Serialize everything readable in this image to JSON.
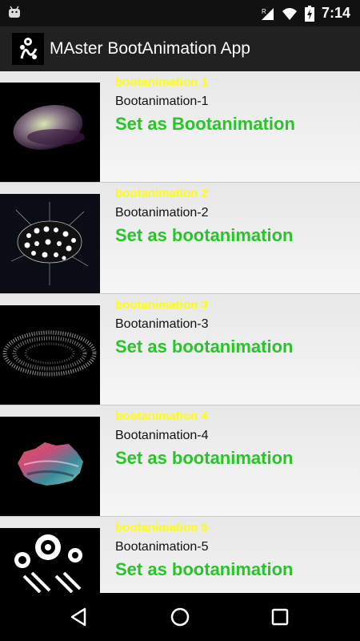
{
  "status_bar": {
    "time": "7:14",
    "icons": [
      "android-icon",
      "signal-r-icon",
      "wifi-icon",
      "battery-charging-icon"
    ]
  },
  "app_bar": {
    "title": "MAster BootAnimation App"
  },
  "items": [
    {
      "name": "bootanimation 1",
      "subtitle": "Bootanimation-1",
      "action": "Set as Bootanimation"
    },
    {
      "name": "bootanimation 2",
      "subtitle": "Bootanimation-2",
      "action": "Set as bootanimation"
    },
    {
      "name": "bootanimation 3",
      "subtitle": "Bootanimation-3",
      "action": "Set as bootanimation"
    },
    {
      "name": "bootanimation 4",
      "subtitle": "Bootanimation-4",
      "action": "Set as bootanimation"
    },
    {
      "name": "bootanimation 5",
      "subtitle": "Bootanimation-5",
      "action": "Set as bootanimation"
    }
  ],
  "nav_bar": {
    "icons": [
      "back-icon",
      "home-icon",
      "recents-icon"
    ]
  },
  "colors": {
    "title_yellow": "#ffff00",
    "action_green": "#29c429",
    "appbar": "#212121",
    "statusbar": "#111111"
  }
}
